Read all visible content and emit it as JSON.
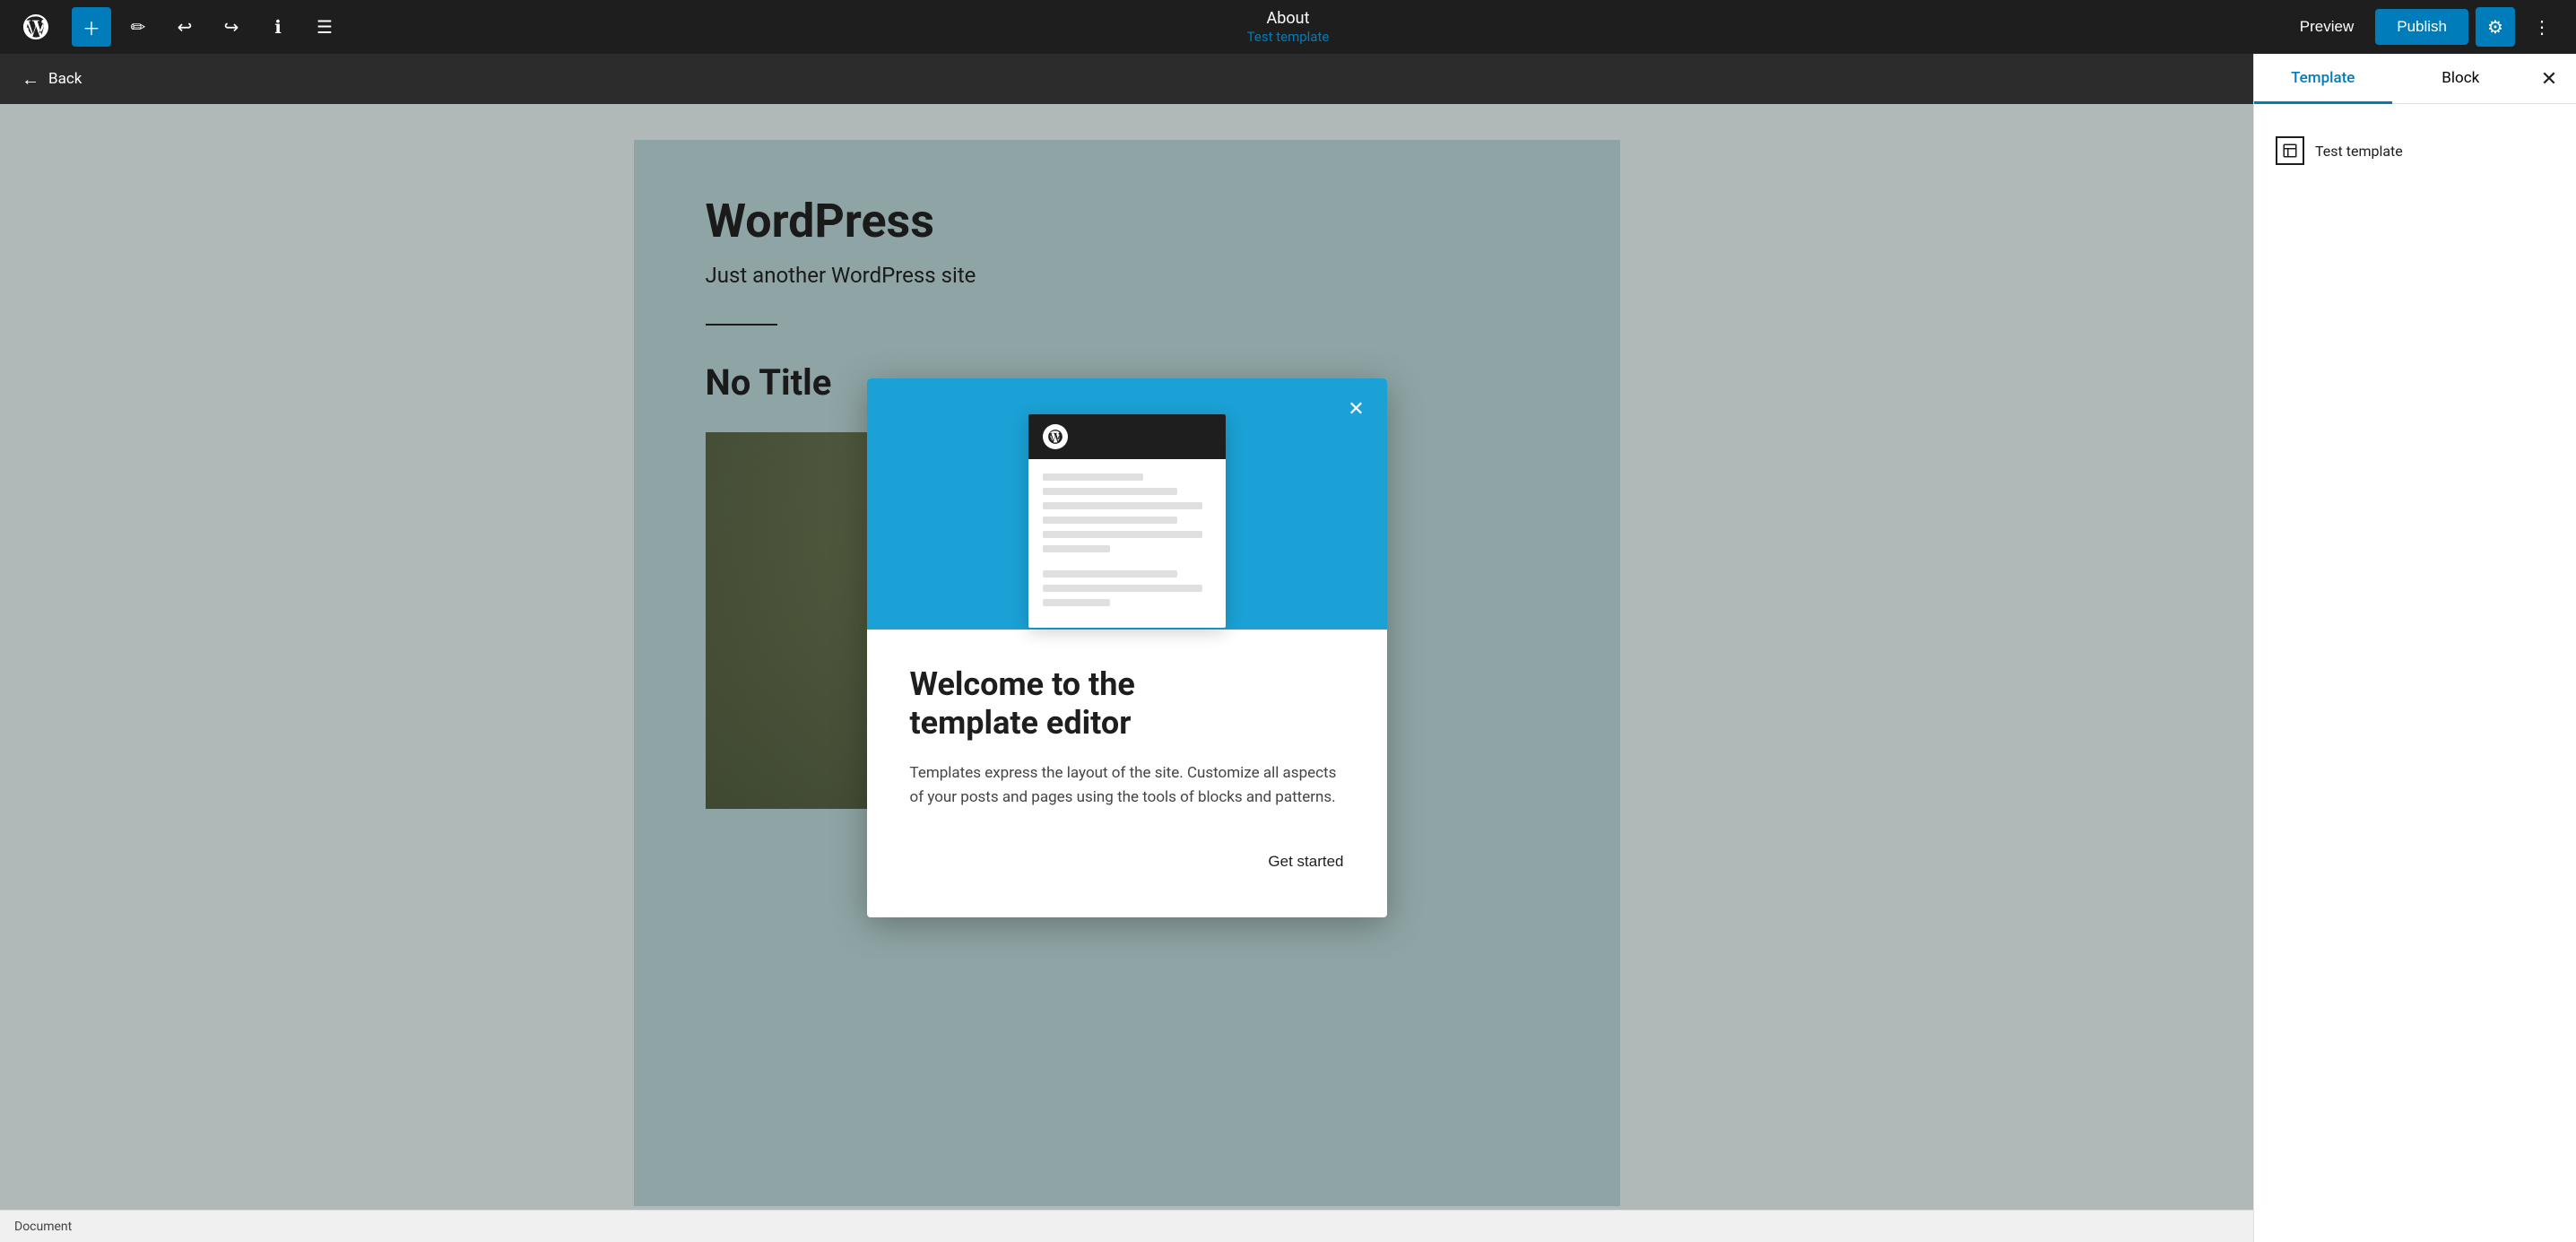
{
  "toolbar": {
    "page_title": "About",
    "template_name": "Test template",
    "preview_label": "Preview",
    "publish_label": "Publish"
  },
  "back_bar": {
    "label": "Back"
  },
  "canvas": {
    "site_title": "WordPress",
    "site_tagline": "Just another WordPress site",
    "post_title": "No Title"
  },
  "right_panel": {
    "tab_template": "Template",
    "tab_block": "Block",
    "template_item_name": "Test template"
  },
  "bottom_bar": {
    "label": "Document"
  },
  "modal": {
    "title": "Welcome to the\ntemplate editor",
    "description": "Templates express the layout of the site. Customize all aspects of your posts and pages using the tools of blocks and patterns.",
    "get_started_label": "Get started"
  }
}
